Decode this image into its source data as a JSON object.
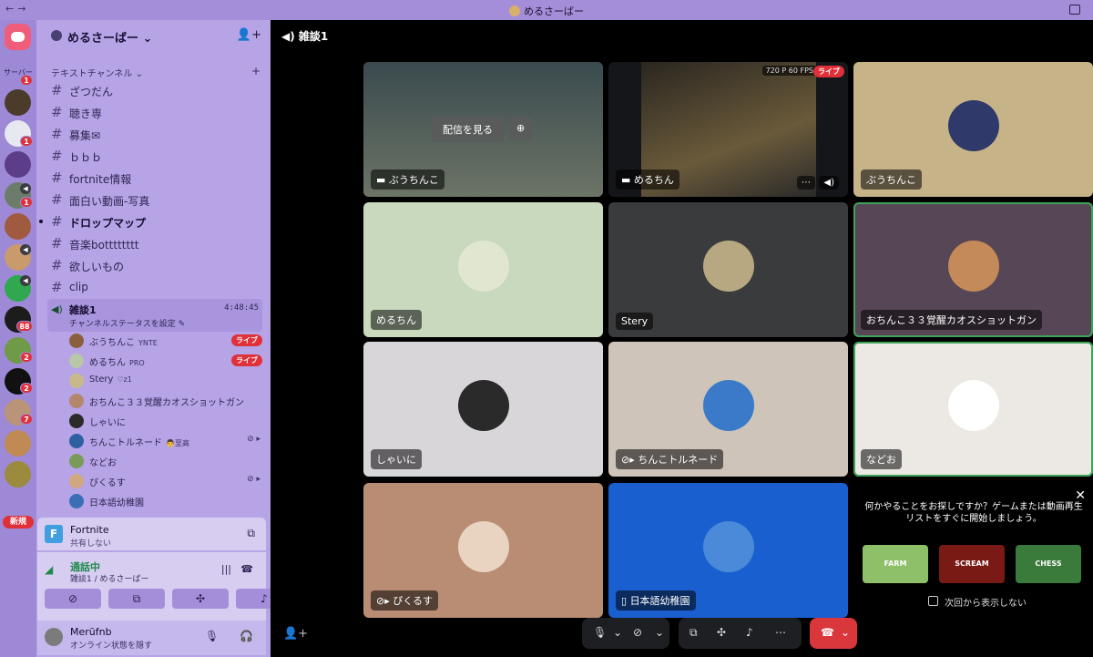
{
  "window": {
    "title": "めるさーばー"
  },
  "rail": {
    "label": "サーバー",
    "new_label": "新規",
    "badges": [
      "1",
      "1",
      "1",
      "1",
      "88",
      "2",
      "2",
      "7"
    ]
  },
  "server": {
    "name": "めるさーばー"
  },
  "category": {
    "name": "テキストチャンネル"
  },
  "channels": [
    {
      "name": "ざつだん"
    },
    {
      "name": "聴き専"
    },
    {
      "name": "募集✉"
    },
    {
      "name": "ｂｂｂ"
    },
    {
      "name": "fortnite情報"
    },
    {
      "name": "面白い動画-写真"
    },
    {
      "name": "ドロップマップ"
    },
    {
      "name": "音楽botttttttt"
    },
    {
      "name": "欲しいもの"
    },
    {
      "name": "clip"
    }
  ],
  "voice": {
    "name": "雑談1",
    "time": "4:48:45",
    "status": "チャンネルステータスを設定"
  },
  "members": [
    {
      "name": "ぶうちんこ",
      "tag": "YNTE",
      "live": "ライブ"
    },
    {
      "name": "めるちん",
      "tag": "PRO",
      "live": "ライブ"
    },
    {
      "name": "Stery",
      "tag": "♡z1"
    },
    {
      "name": "おちんこ３３覚醒カオスショットガン"
    },
    {
      "name": "しゃいに"
    },
    {
      "name": "ちんこトルネード",
      "tag": "👨至高"
    },
    {
      "name": "などお"
    },
    {
      "name": "ぴくるす"
    },
    {
      "name": "日本語幼稚園"
    }
  ],
  "activity": {
    "game": "Fortnite",
    "share": "共有しない"
  },
  "call": {
    "status": "通話中",
    "detail": "雑談1 / めるさーばー"
  },
  "user": {
    "name": "Merūfnb",
    "status": "オンライン状態を隠す"
  },
  "main": {
    "channel_title": "雑談1",
    "watch_label": "配信を見る",
    "fps_label": "720 P 60 FPS",
    "live_label": "ライブ",
    "tiles": [
      {
        "name": "ぶうちんこ"
      },
      {
        "name": "めるちん"
      },
      {
        "name": "ぶうちんこ"
      },
      {
        "name": "めるちん"
      },
      {
        "name": "Stery"
      },
      {
        "name": "おちんこ３３覚醒カオスショットガン"
      },
      {
        "name": "しゃいに"
      },
      {
        "name": "ちんこトルネード"
      },
      {
        "name": "などお"
      },
      {
        "name": "ぴくるす"
      },
      {
        "name": "日本語幼稚園"
      }
    ],
    "suggest": {
      "message": "何かやることをお探しですか？ゲームまたは動画再生リストをすぐに開始しましょう。",
      "games": [
        "FARM",
        "SCREAM",
        "CHESS"
      ],
      "checkbox_label": "次回から表示しない"
    }
  },
  "colors": {
    "rail": "#9d89d6",
    "sidebar": "#b6a4e6",
    "live": "#e0303a",
    "connected": "#1f8a4c",
    "hangup": "#da373c"
  }
}
